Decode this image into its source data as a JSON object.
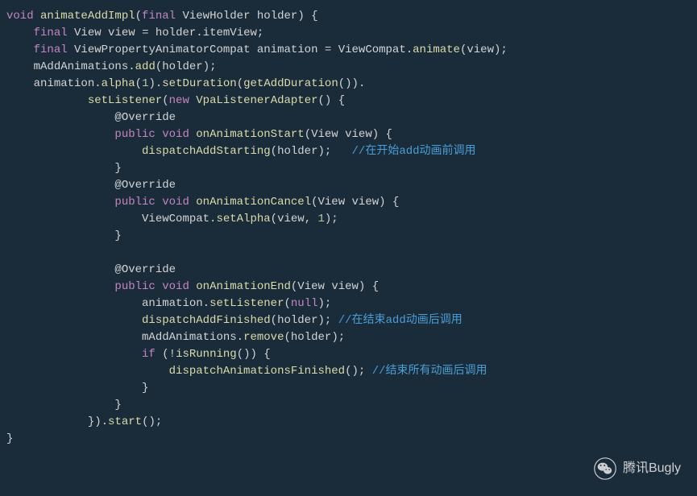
{
  "code": {
    "l1": {
      "kw1": "void",
      "fn": "animateAddImpl",
      "kw2": "final",
      "type": "ViewHolder",
      "param": "holder"
    },
    "l2": {
      "kw": "final",
      "type": "View",
      "var": "view",
      "eq": "=",
      "rhs": "holder.itemView;"
    },
    "l3": {
      "kw": "final",
      "type": "ViewPropertyAnimatorCompat",
      "var": "animation",
      "eq": "=",
      "cls": "ViewCompat",
      "dot": ".",
      "m": "animate",
      "arg": "view"
    },
    "l4": {
      "obj": "mAddAnimations",
      "m": "add",
      "arg": "holder"
    },
    "l5": {
      "obj": "animation",
      "m1": "alpha",
      "n": "1",
      "m2": "setDuration",
      "m3": "getAddDuration"
    },
    "l6": {
      "m": "setListener",
      "kw": "new",
      "cls": "VpaListenerAdapter"
    },
    "l7": {
      "annot": "@Override"
    },
    "l8": {
      "kw1": "public",
      "kw2": "void",
      "fn": "onAnimationStart",
      "type": "View",
      "param": "view"
    },
    "l9": {
      "m": "dispatchAddStarting",
      "arg": "holder",
      "comment": "//在开始add动画前调用"
    },
    "l10": {
      "brace": "}"
    },
    "l11": {
      "annot": "@Override"
    },
    "l12": {
      "kw1": "public",
      "kw2": "void",
      "fn": "onAnimationCancel",
      "type": "View",
      "param": "view"
    },
    "l13": {
      "cls": "ViewCompat",
      "m": "setAlpha",
      "arg": "view",
      "n": "1"
    },
    "l14": {
      "brace": "}"
    },
    "l16": {
      "annot": "@Override"
    },
    "l17": {
      "kw1": "public",
      "kw2": "void",
      "fn": "onAnimationEnd",
      "type": "View",
      "param": "view"
    },
    "l18": {
      "obj": "animation",
      "m": "setListener",
      "arg": "null"
    },
    "l19": {
      "m": "dispatchAddFinished",
      "arg": "holder",
      "comment": "//在结束add动画后调用"
    },
    "l20": {
      "obj": "mAddAnimations",
      "m": "remove",
      "arg": "holder"
    },
    "l21": {
      "kw": "if",
      "m": "isRunning"
    },
    "l22": {
      "m": "dispatchAnimationsFinished",
      "comment": "//结束所有动画后调用"
    },
    "l23": {
      "brace": "}"
    },
    "l24": {
      "brace": "}"
    },
    "l25": {
      "m": "start"
    },
    "l26": {
      "brace": "}"
    }
  },
  "watermark": {
    "text": "腾讯Bugly"
  }
}
